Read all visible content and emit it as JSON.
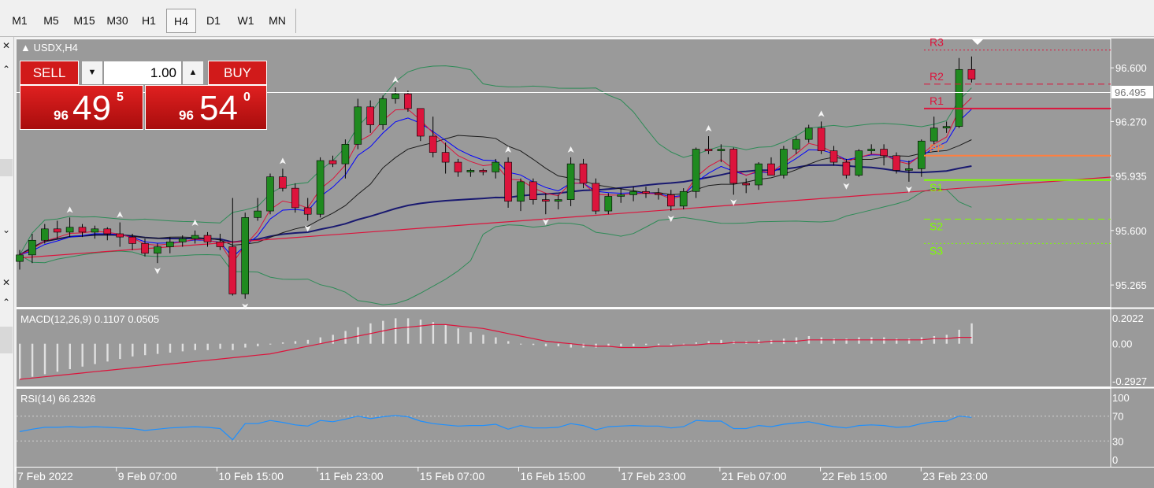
{
  "timeframes": [
    "M1",
    "M5",
    "M15",
    "M30",
    "H1",
    "H4",
    "D1",
    "W1",
    "MN"
  ],
  "active_timeframe": "H4",
  "symbol_label": "USDX,H4",
  "trade_panel": {
    "sell_label": "SELL",
    "buy_label": "BUY",
    "volume": "1.00",
    "sell_price": {
      "big": "96",
      "main": "49",
      "sup": "5"
    },
    "buy_price": {
      "big": "96",
      "main": "54",
      "sup": "0"
    }
  },
  "price_axis": {
    "ticks": [
      "96.600",
      "96.270",
      "95.935",
      "95.600",
      "95.265"
    ],
    "current": "96.495"
  },
  "pivot_labels": [
    "R3",
    "R2",
    "R1",
    "PP",
    "S1",
    "S2",
    "S3"
  ],
  "macd": {
    "label": "MACD(12,26,9) 0.1107 0.0505",
    "ticks": [
      "0.2022",
      "0.00",
      "-0.2927"
    ]
  },
  "rsi": {
    "label": "RSI(14) 66.2326",
    "ticks": [
      "100",
      "70",
      "30",
      "0"
    ]
  },
  "time_axis": [
    "7 Feb 2022",
    "9 Feb 07:00",
    "10 Feb 15:00",
    "11 Feb 23:00",
    "15 Feb 07:00",
    "16 Feb 15:00",
    "17 Feb 23:00",
    "21 Feb 07:00",
    "22 Feb 15:00",
    "23 Feb 23:00"
  ],
  "colors": {
    "chart_bg": "#9a9a9a",
    "bull": "#1f8a1f",
    "bear": "#dc143c",
    "sell_button": "#d11a1a",
    "pivot_r": "#dc143c",
    "pivot_pp": "#ff7f3f",
    "pivot_s": "#7fff00",
    "rsi_line": "#1e90ff"
  },
  "chart_data": {
    "type": "candlestick",
    "title": "USDX,H4",
    "candles": [
      [
        95.41,
        95.48,
        95.36,
        95.45
      ],
      [
        95.45,
        95.58,
        95.4,
        95.54
      ],
      [
        95.54,
        95.64,
        95.52,
        95.61
      ],
      [
        95.61,
        95.66,
        95.55,
        95.59
      ],
      [
        95.59,
        95.68,
        95.56,
        95.62
      ],
      [
        95.62,
        95.64,
        95.56,
        95.59
      ],
      [
        95.59,
        95.63,
        95.55,
        95.61
      ],
      [
        95.61,
        95.62,
        95.54,
        95.58
      ],
      [
        95.58,
        95.65,
        95.5,
        95.56
      ],
      [
        95.56,
        95.58,
        95.48,
        95.52
      ],
      [
        95.52,
        95.55,
        95.44,
        95.46
      ],
      [
        95.46,
        95.52,
        95.4,
        95.5
      ],
      [
        95.5,
        95.56,
        95.46,
        95.53
      ],
      [
        95.53,
        95.57,
        95.5,
        95.55
      ],
      [
        95.55,
        95.6,
        95.52,
        95.57
      ],
      [
        95.57,
        95.59,
        95.5,
        95.53
      ],
      [
        95.53,
        95.58,
        95.48,
        95.5
      ],
      [
        95.5,
        95.8,
        95.2,
        95.21
      ],
      [
        95.21,
        95.71,
        95.18,
        95.68
      ],
      [
        95.68,
        95.8,
        95.66,
        95.72
      ],
      [
        95.72,
        95.95,
        95.7,
        95.93
      ],
      [
        95.93,
        95.98,
        95.84,
        95.86
      ],
      [
        95.86,
        95.89,
        95.71,
        95.74
      ],
      [
        95.74,
        95.8,
        95.66,
        95.7
      ],
      [
        95.7,
        96.05,
        95.68,
        96.03
      ],
      [
        96.03,
        96.06,
        95.99,
        96.01
      ],
      [
        96.01,
        96.16,
        95.92,
        96.13
      ],
      [
        96.13,
        96.41,
        96.1,
        96.36
      ],
      [
        96.36,
        96.4,
        96.2,
        96.25
      ],
      [
        96.25,
        96.43,
        96.22,
        96.41
      ],
      [
        96.41,
        96.48,
        96.38,
        96.44
      ],
      [
        96.44,
        96.46,
        96.33,
        96.35
      ],
      [
        96.35,
        96.33,
        96.15,
        96.18
      ],
      [
        96.18,
        96.3,
        96.05,
        96.08
      ],
      [
        96.08,
        96.14,
        95.95,
        96.02
      ],
      [
        96.02,
        96.04,
        95.93,
        95.96
      ],
      [
        95.96,
        95.98,
        95.93,
        95.97
      ],
      [
        95.97,
        95.98,
        95.94,
        95.96
      ],
      [
        95.96,
        96.04,
        95.92,
        96.02
      ],
      [
        96.02,
        96.05,
        95.74,
        95.78
      ],
      [
        95.78,
        95.92,
        95.72,
        95.9
      ],
      [
        95.9,
        95.92,
        95.76,
        95.79
      ],
      [
        95.79,
        95.83,
        95.7,
        95.78
      ],
      [
        95.78,
        95.82,
        95.73,
        95.79
      ],
      [
        95.79,
        96.05,
        95.75,
        96.01
      ],
      [
        96.01,
        96.04,
        95.86,
        95.89
      ],
      [
        95.89,
        95.92,
        95.7,
        95.72
      ],
      [
        95.72,
        95.83,
        95.7,
        95.81
      ],
      [
        95.81,
        95.86,
        95.77,
        95.82
      ],
      [
        95.82,
        95.87,
        95.78,
        95.84
      ],
      [
        95.84,
        95.87,
        95.8,
        95.83
      ],
      [
        95.83,
        95.86,
        95.79,
        95.82
      ],
      [
        95.82,
        95.85,
        95.72,
        95.75
      ],
      [
        95.75,
        95.86,
        95.73,
        95.84
      ],
      [
        95.84,
        96.11,
        95.8,
        96.1
      ],
      [
        96.1,
        96.18,
        96.07,
        96.09
      ],
      [
        96.09,
        96.13,
        96.02,
        96.1
      ],
      [
        96.1,
        96.11,
        95.82,
        95.89
      ],
      [
        95.89,
        95.92,
        95.83,
        95.88
      ],
      [
        95.88,
        96.02,
        95.85,
        96.01
      ],
      [
        96.01,
        96.05,
        95.94,
        95.94
      ],
      [
        95.94,
        96.12,
        95.92,
        96.1
      ],
      [
        96.1,
        96.18,
        96.07,
        96.16
      ],
      [
        96.16,
        96.25,
        96.14,
        96.23
      ],
      [
        96.23,
        96.27,
        96.07,
        96.09
      ],
      [
        96.09,
        96.12,
        96.0,
        96.02
      ],
      [
        96.02,
        96.04,
        95.92,
        95.94
      ],
      [
        95.94,
        96.1,
        95.93,
        96.09
      ],
      [
        96.09,
        96.13,
        96.07,
        96.1
      ],
      [
        96.1,
        96.13,
        96.0,
        96.06
      ],
      [
        96.06,
        96.08,
        95.95,
        95.97
      ],
      [
        95.97,
        96.03,
        95.9,
        95.98
      ],
      [
        95.98,
        96.16,
        95.93,
        96.15
      ],
      [
        96.15,
        96.3,
        96.13,
        96.23
      ],
      [
        96.23,
        96.27,
        96.2,
        96.24
      ],
      [
        96.24,
        96.66,
        96.23,
        96.59
      ],
      [
        96.59,
        96.67,
        96.51,
        96.53
      ]
    ],
    "pivots": {
      "R3": 96.71,
      "R2": 96.5,
      "R1": 96.35,
      "PP": 96.06,
      "S1": 95.91,
      "S2": 95.67,
      "S3": 95.52
    },
    "current_price": 96.495,
    "y_range": [
      95.13,
      96.78
    ],
    "macd_hist": [
      -0.28,
      -0.26,
      -0.24,
      -0.22,
      -0.2,
      -0.18,
      -0.16,
      -0.14,
      -0.12,
      -0.1,
      -0.09,
      -0.08,
      -0.07,
      -0.06,
      -0.05,
      -0.05,
      -0.04,
      -0.05,
      -0.03,
      -0.02,
      0.0,
      0.01,
      0.02,
      0.03,
      0.05,
      0.07,
      0.1,
      0.13,
      0.16,
      0.18,
      0.2,
      0.2,
      0.19,
      0.17,
      0.15,
      0.12,
      0.09,
      0.07,
      0.05,
      0.02,
      0.0,
      -0.01,
      -0.02,
      -0.02,
      -0.03,
      -0.03,
      -0.03,
      -0.02,
      -0.02,
      -0.02,
      -0.01,
      -0.01,
      -0.01,
      0.0,
      0.01,
      0.02,
      0.03,
      0.02,
      0.02,
      0.03,
      0.03,
      0.04,
      0.05,
      0.06,
      0.05,
      0.04,
      0.04,
      0.05,
      0.05,
      0.05,
      0.04,
      0.04,
      0.05,
      0.06,
      0.07,
      0.11,
      0.16
    ],
    "macd_signal": [
      -0.28,
      -0.27,
      -0.26,
      -0.25,
      -0.24,
      -0.23,
      -0.22,
      -0.21,
      -0.2,
      -0.19,
      -0.18,
      -0.17,
      -0.16,
      -0.15,
      -0.14,
      -0.13,
      -0.12,
      -0.11,
      -0.1,
      -0.09,
      -0.08,
      -0.06,
      -0.04,
      -0.02,
      0.0,
      0.02,
      0.04,
      0.06,
      0.08,
      0.1,
      0.12,
      0.13,
      0.14,
      0.15,
      0.15,
      0.14,
      0.13,
      0.12,
      0.1,
      0.08,
      0.06,
      0.04,
      0.02,
      0.01,
      0.0,
      -0.01,
      -0.02,
      -0.02,
      -0.03,
      -0.03,
      -0.03,
      -0.02,
      -0.02,
      -0.01,
      -0.01,
      0.0,
      0.0,
      0.01,
      0.01,
      0.01,
      0.02,
      0.02,
      0.02,
      0.03,
      0.03,
      0.03,
      0.03,
      0.03,
      0.03,
      0.03,
      0.03,
      0.03,
      0.03,
      0.04,
      0.04,
      0.05,
      0.05
    ],
    "rsi": [
      45,
      49,
      52,
      52,
      53,
      52,
      53,
      52,
      51,
      50,
      47,
      49,
      51,
      52,
      53,
      52,
      50,
      32,
      58,
      58,
      63,
      60,
      56,
      54,
      63,
      61,
      65,
      70,
      66,
      69,
      71,
      69,
      62,
      58,
      56,
      54,
      55,
      55,
      57,
      49,
      55,
      51,
      51,
      52,
      58,
      55,
      48,
      53,
      54,
      55,
      54,
      54,
      51,
      53,
      63,
      62,
      62,
      50,
      50,
      55,
      53,
      57,
      59,
      61,
      57,
      53,
      51,
      55,
      56,
      55,
      52,
      53,
      58,
      61,
      62,
      70,
      68
    ]
  }
}
